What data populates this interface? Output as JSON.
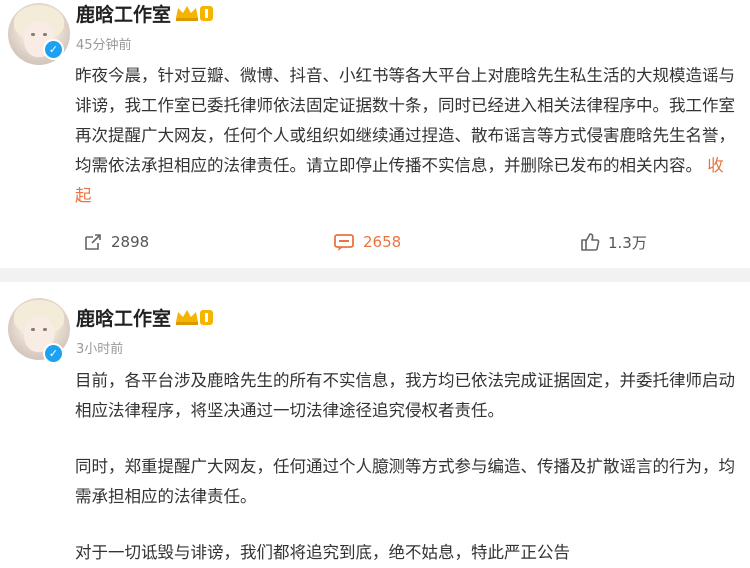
{
  "posts": [
    {
      "username": "鹿晗工作室",
      "time": "45分钟前",
      "text": "昨夜今晨，针对豆瓣、微博、抖音、小红书等各大平台上对鹿晗先生私生活的大规模造谣与诽谤，我工作室已委托律师依法固定证据数十条，同时已经进入相关法律程序中。我工作室再次提醒广大网友，任何个人或组织如继续通过捏造、散布谣言等方式侵害鹿晗先生名誉，均需依法承担相应的法律责任。请立即停止传播不实信息，并删除已发布的相关内容。",
      "collapse_label": "收起",
      "actions": {
        "repost": "2898",
        "comment": "2658",
        "like": "1.3万"
      }
    },
    {
      "username": "鹿晗工作室",
      "time": "3小时前",
      "paragraphs": [
        "目前，各平台涉及鹿晗先生的所有不实信息，我方均已依法完成证据固定，并委托律师启动相应法律程序，将坚决通过一切法律途径追究侵权者责任。",
        "同时，郑重提醒广大网友，任何通过个人臆测等方式参与编造、传播及扩散谣言的行为，均需承担相应的法律责任。",
        "对于一切诋毁与诽谤，我们都将追究到底，绝不姑息，特此严正公告"
      ]
    }
  ],
  "colors": {
    "accent": "#eb7340",
    "verified": "#1da1f2",
    "crown": "#f5b400"
  },
  "icons": [
    "verified-icon",
    "crown-badge-icon",
    "repost-icon",
    "comment-icon",
    "like-icon"
  ]
}
